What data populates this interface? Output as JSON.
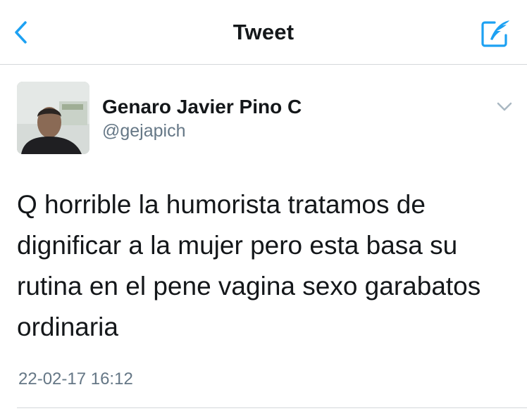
{
  "colors": {
    "accent": "#1da1f2",
    "text_primary": "#14171a",
    "text_secondary": "#657786",
    "divider": "#d4d7da"
  },
  "navbar": {
    "title": "Tweet",
    "back_icon": "chevron-left-icon",
    "compose_icon": "compose-tweet-icon"
  },
  "tweet": {
    "author": {
      "display_name": "Genaro Javier Pino C",
      "handle": "@gejapich",
      "avatar_icon": "user-avatar-photo"
    },
    "menu_icon": "chevron-down-icon",
    "text": "Q horrible la humorista tratamos de\ndignificar a la mujer pero esta basa su\nrutina en el pene vagina sexo garabatos\nordinaria",
    "timestamp": "22-02-17 16:12"
  }
}
